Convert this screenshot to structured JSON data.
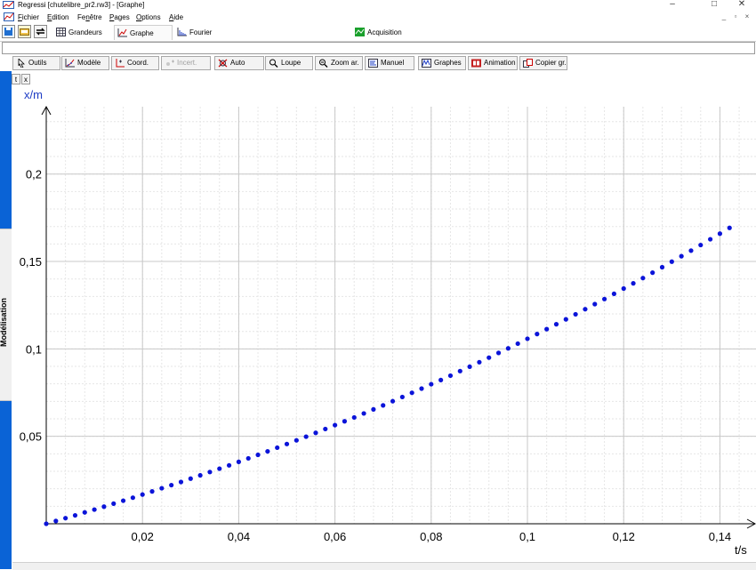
{
  "window": {
    "title": "Regressi [chutelibre_pr2.rw3] - [Graphe]",
    "controls": [
      "–",
      "□",
      "✕"
    ]
  },
  "menubar": {
    "items": [
      {
        "label": "Fichier",
        "u": "F",
        "rest": "ichier"
      },
      {
        "label": "Edition",
        "u": "E",
        "rest": "dition"
      },
      {
        "label": "Fenêtre",
        "pre": "Fe",
        "u": "n",
        "rest": "être"
      },
      {
        "label": "Pages",
        "u": "P",
        "rest": "ages"
      },
      {
        "label": "Options",
        "u": "O",
        "rest": "ptions"
      },
      {
        "label": "Aide",
        "u": "A",
        "rest": "ide"
      }
    ],
    "mdi_controls": [
      "_",
      "▫",
      "×"
    ]
  },
  "tabs": {
    "grandeurs": "Grandeurs",
    "graphe": "Graphe",
    "fourier": "Fourier",
    "acquisition": "Acquisition"
  },
  "toolbar": {
    "outils": "Outils",
    "modele": "Modèle",
    "coord": "Coord.",
    "incert": "Incert.",
    "auto": "Auto",
    "loupe": "Loupe",
    "zoom": "Zoom ar.",
    "manuel": "Manuel",
    "graphes": "Graphes",
    "animation": "Animation",
    "copier": "Copier gr."
  },
  "axis_buttons": {
    "t": "t",
    "x": "x"
  },
  "sidebar": {
    "label": "Modélisation"
  },
  "colors": {
    "accent": "#0a63d6",
    "points": "#0b14d9",
    "ylabel": "#1d3cc4"
  },
  "chart_data": {
    "type": "scatter",
    "xlabel": "t/s",
    "ylabel": "x/m",
    "xlim": [
      0,
      0.1475
    ],
    "ylim": [
      0,
      0.2385
    ],
    "xticks": [
      0.02,
      0.04,
      0.06,
      0.08,
      0.1,
      0.12,
      0.14
    ],
    "xtick_labels": [
      "0,02",
      "0,04",
      "0,06",
      "0,08",
      "0,1",
      "0,12",
      "0,14"
    ],
    "yticks": [
      0.05,
      0.1,
      0.15,
      0.2
    ],
    "ytick_labels": [
      "0,05",
      "0,1",
      "0,15",
      "0,2"
    ],
    "grid": true,
    "series": [
      {
        "x": [
          0,
          0.002,
          0.004,
          0.006,
          0.008,
          0.01,
          0.012,
          0.014,
          0.016,
          0.018,
          0.02,
          0.022,
          0.024,
          0.026,
          0.028,
          0.03,
          0.032,
          0.034,
          0.036,
          0.038,
          0.04,
          0.042,
          0.044,
          0.046,
          0.048,
          0.05,
          0.052,
          0.054,
          0.056,
          0.058,
          0.06,
          0.062,
          0.064,
          0.066,
          0.068,
          0.07,
          0.072,
          0.074,
          0.076,
          0.078,
          0.08,
          0.082,
          0.084,
          0.086,
          0.088,
          0.09,
          0.092,
          0.094,
          0.096,
          0.098,
          0.1,
          0.102,
          0.104,
          0.106,
          0.108,
          0.11,
          0.112,
          0.114,
          0.116,
          0.118,
          0.12,
          0.122,
          0.124,
          0.126,
          0.128,
          0.13,
          0.132,
          0.134,
          0.136,
          0.138,
          0.14,
          0.142
        ],
        "y": [
          0,
          0.0016,
          0.0032,
          0.0048,
          0.0065,
          0.0081,
          0.0098,
          0.0115,
          0.0132,
          0.0149,
          0.0167,
          0.0185,
          0.0203,
          0.0221,
          0.0239,
          0.0258,
          0.0277,
          0.0296,
          0.0315,
          0.0334,
          0.0354,
          0.0374,
          0.0394,
          0.0414,
          0.0435,
          0.0456,
          0.0477,
          0.0498,
          0.052,
          0.0542,
          0.0564,
          0.0586,
          0.0608,
          0.0631,
          0.0654,
          0.0677,
          0.0701,
          0.0725,
          0.0749,
          0.0773,
          0.0798,
          0.0822,
          0.0847,
          0.0873,
          0.0898,
          0.0924,
          0.095,
          0.0977,
          0.1003,
          0.103,
          0.1058,
          0.1085,
          0.1113,
          0.1141,
          0.1169,
          0.1198,
          0.1227,
          0.1256,
          0.1285,
          0.1315,
          0.1345,
          0.1375,
          0.1405,
          0.1436,
          0.1467,
          0.1499,
          0.153,
          0.1562,
          0.1594,
          0.1627,
          0.1659,
          0.1692
        ]
      }
    ]
  }
}
